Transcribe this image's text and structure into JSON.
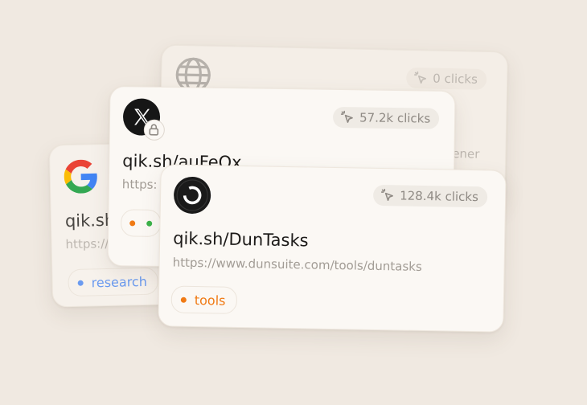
{
  "colors": {
    "background": "#f0e9e1",
    "card": "#fbf8f4",
    "muted_text": "#8f8a84",
    "tag_blue": "#6b9bf0",
    "tag_orange": "#f07a14",
    "tag_green": "#3bb24a"
  },
  "cards": {
    "globe": {
      "icon": "globe-icon",
      "clicks": "0 clicks",
      "partial_text": "ener"
    },
    "google": {
      "icon": "google-icon",
      "short_url": "qik.sh",
      "long_url": "https://",
      "tag": {
        "label": "research",
        "color": "#6b9bf0"
      }
    },
    "x": {
      "icon": "x-logo-icon",
      "lock_icon": "lock-icon",
      "clicks": "57.2k clicks",
      "short_url": "qik.sh/auFeQx",
      "long_url": "https:",
      "tag_dots": [
        "#f07a14",
        "#3bb24a"
      ]
    },
    "dun": {
      "icon": "dun-logo-icon",
      "clicks": "128.4k clicks",
      "short_url": "qik.sh/DunTasks",
      "long_url": "https://www.dunsuite.com/tools/duntasks",
      "tag": {
        "label": "tools",
        "color": "#f07a14"
      }
    }
  }
}
